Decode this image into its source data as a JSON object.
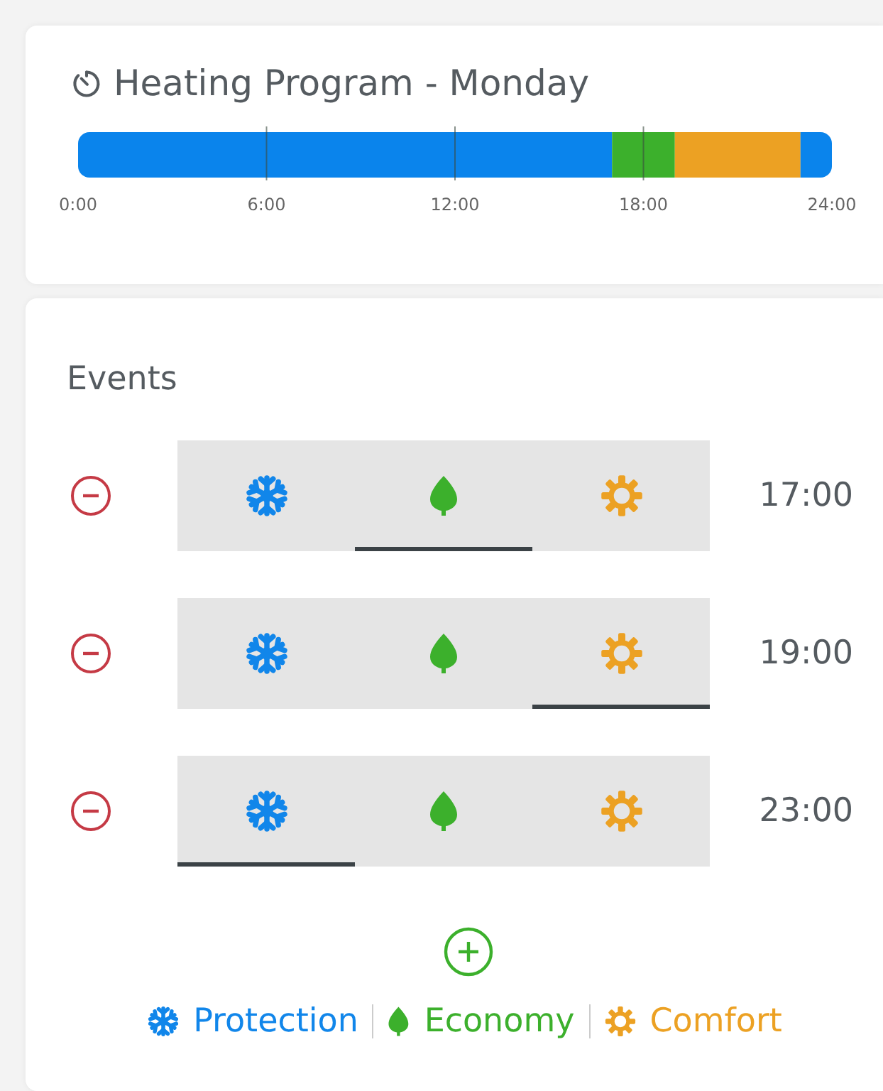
{
  "program": {
    "title": "Heating Program - Monday",
    "chart_data": {
      "type": "bar",
      "orientation": "horizontal",
      "stacked": true,
      "grid": true,
      "xlim": [
        0,
        24
      ],
      "xticks": [
        {
          "value": 0,
          "label": "0:00"
        },
        {
          "value": 6,
          "label": "6:00"
        },
        {
          "value": 12,
          "label": "12:00"
        },
        {
          "value": 18,
          "label": "18:00"
        },
        {
          "value": 24,
          "label": "24:00"
        }
      ],
      "series": [
        {
          "color": "#0a84ec",
          "values": [
            17
          ]
        },
        {
          "color": "#3cb02c",
          "values": [
            2
          ]
        },
        {
          "color": "#eca123",
          "values": [
            4
          ]
        },
        {
          "color": "#0a84ec",
          "values": [
            1
          ]
        }
      ]
    }
  },
  "events": {
    "title": "Events",
    "rows": [
      {
        "modes": [
          {
            "kind": "protection",
            "selected": false
          },
          {
            "kind": "economy",
            "selected": true
          },
          {
            "kind": "comfort",
            "selected": false
          }
        ],
        "time": "17:00"
      },
      {
        "modes": [
          {
            "kind": "protection",
            "selected": false
          },
          {
            "kind": "economy",
            "selected": false
          },
          {
            "kind": "comfort",
            "selected": true
          }
        ],
        "time": "19:00"
      },
      {
        "modes": [
          {
            "kind": "protection",
            "selected": true
          },
          {
            "kind": "economy",
            "selected": false
          },
          {
            "kind": "comfort",
            "selected": false
          }
        ],
        "time": "23:00"
      }
    ],
    "legend": [
      {
        "kind": "protection",
        "label": "Protection"
      },
      {
        "kind": "economy",
        "label": "Economy"
      },
      {
        "kind": "comfort",
        "label": "Comfort"
      }
    ]
  }
}
